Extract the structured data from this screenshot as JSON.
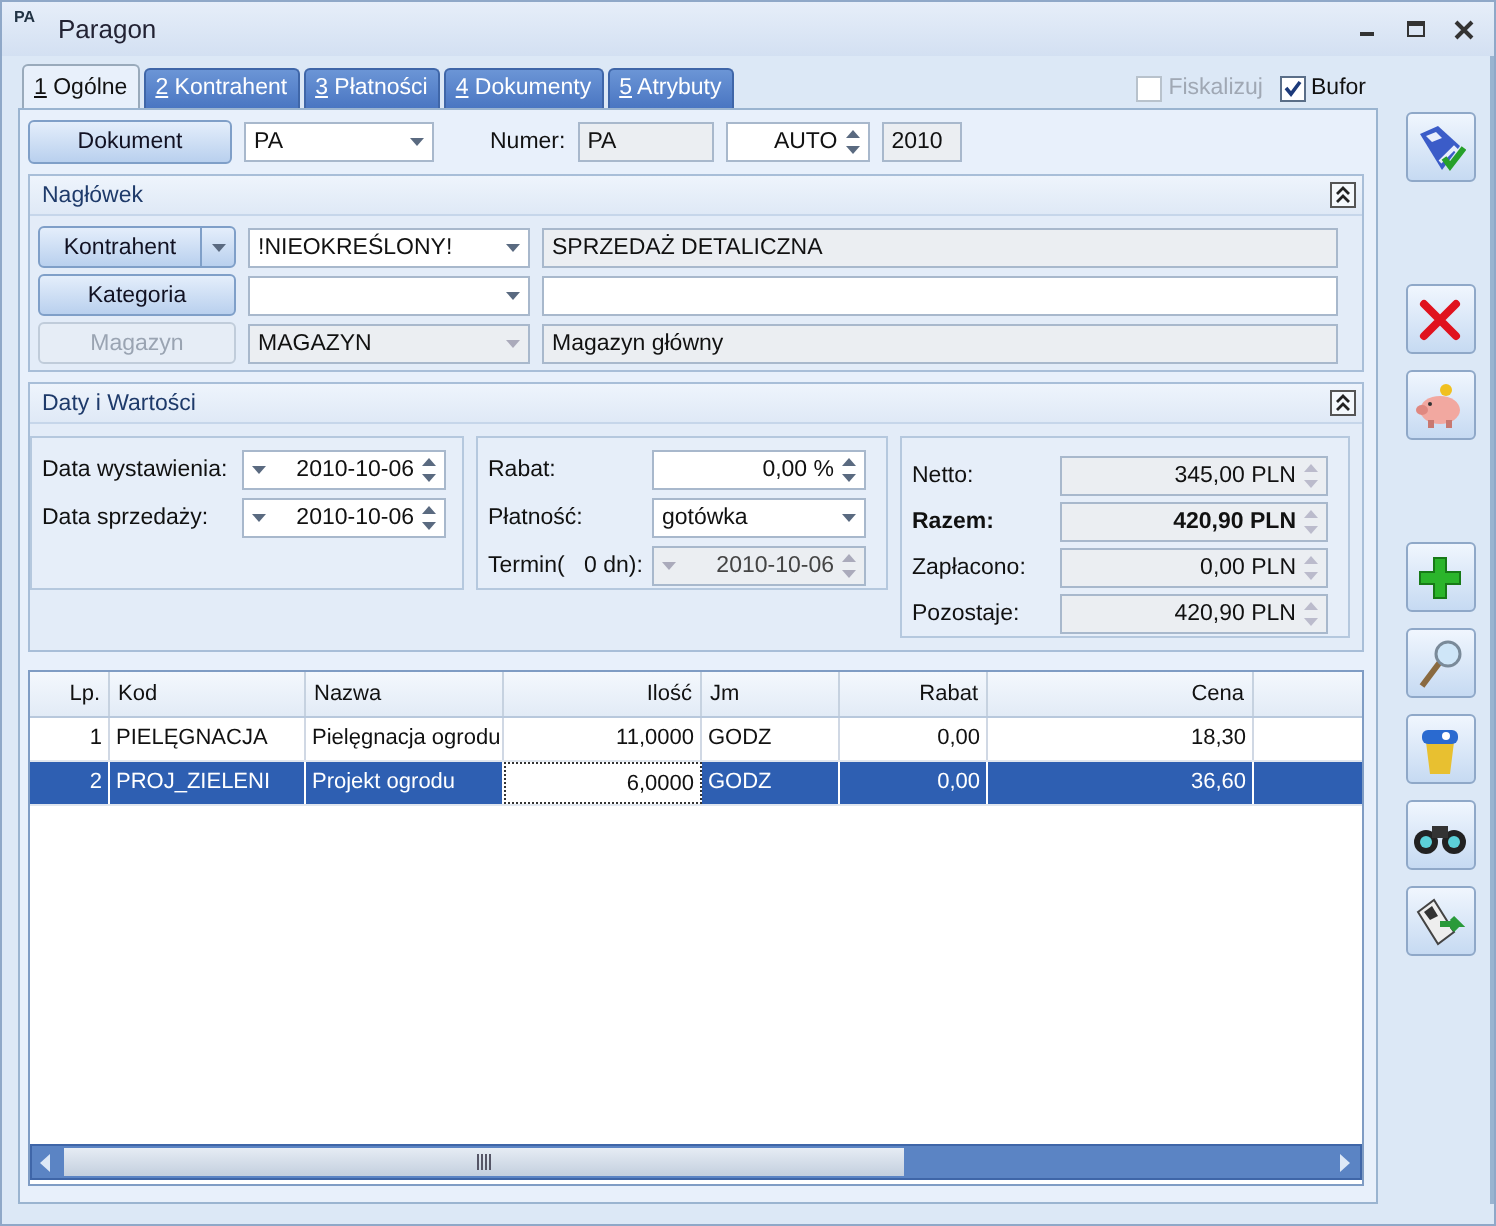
{
  "window": {
    "title": "Paragon",
    "icon_text": "PA"
  },
  "tabs": [
    {
      "key": "1",
      "label": "Ogólne",
      "selected": true
    },
    {
      "key": "2",
      "label": "Kontrahent",
      "selected": false
    },
    {
      "key": "3",
      "label": "Płatności",
      "selected": false
    },
    {
      "key": "4",
      "label": "Dokumenty",
      "selected": false
    },
    {
      "key": "5",
      "label": "Atrybuty",
      "selected": false
    }
  ],
  "options": [
    {
      "label": "Fiskalizuj",
      "checked": false,
      "disabled": true
    },
    {
      "label": "Bufor",
      "checked": true,
      "disabled": false
    }
  ],
  "document": {
    "button": "Dokument",
    "type": "PA",
    "number_label": "Numer:",
    "number_prefix": "PA",
    "number_mode": "AUTO",
    "number_year": "2010"
  },
  "header": {
    "title": "Nagłówek",
    "expanded": true,
    "rows": [
      {
        "button": "Kontrahent",
        "split": true,
        "disabled": false,
        "select": "!NIEOKREŚLONY!",
        "select_disabled": false,
        "text": "SPRZEDAŻ DETALICZNA",
        "text_readonly": true
      },
      {
        "button": "Kategoria",
        "split": false,
        "disabled": false,
        "text_readonly": false,
        "select_disabled": false
      },
      {
        "button": "Magazyn",
        "split": false,
        "disabled": true,
        "select": "MAGAZYN",
        "select_disabled": true,
        "text": "Magazyn główny",
        "text_readonly": true
      }
    ]
  },
  "dates_values": {
    "title": "Daty i Wartości",
    "expanded": true,
    "dates": [
      {
        "label": "Data wystawienia:",
        "value": "2010-10-06"
      },
      {
        "label": "Data sprzedaży:",
        "value": "2010-10-06"
      }
    ],
    "discount": {
      "label": "Rabat:",
      "value": "0,00 %"
    },
    "payment": {
      "label": "Płatność:",
      "value": "gotówka"
    },
    "term": {
      "label": "Termin(",
      "days": "0 dn):",
      "value": "2010-10-06",
      "disabled": true
    },
    "totals": [
      {
        "label": "Netto:",
        "value": "345,00 PLN",
        "bold": false
      },
      {
        "label": "Razem:",
        "value": "420,90 PLN",
        "bold": true
      },
      {
        "label": "Zapłacono:",
        "value": "0,00 PLN",
        "bold": false
      },
      {
        "label": "Pozostaje:",
        "value": "420,90 PLN",
        "bold": false
      }
    ]
  },
  "table": {
    "columns": [
      "Lp.",
      "Kod",
      "Nazwa",
      "Ilość",
      "Jm",
      "Rabat",
      "Cena"
    ],
    "rows": [
      {
        "cells": [
          "1",
          "PIELĘGNACJA",
          "Pielęgnacja ogrodu",
          "11,0000",
          "GODZ",
          "0,00",
          "18,30"
        ],
        "selected": false
      },
      {
        "cells": [
          "2",
          "PROJ_ZIELENI",
          "Projekt ogrodu",
          "6,0000",
          "GODZ",
          "0,00",
          "36,60"
        ],
        "selected": true
      }
    ]
  },
  "toolbar_groups": [
    [
      {
        "kind": "save"
      }
    ],
    [
      {
        "kind": "delete"
      },
      {
        "kind": "piggy"
      }
    ],
    [
      {
        "kind": "add"
      },
      {
        "kind": "magnifier"
      },
      {
        "kind": "bin"
      },
      {
        "kind": "binoculars"
      },
      {
        "kind": "terminal"
      }
    ]
  ]
}
